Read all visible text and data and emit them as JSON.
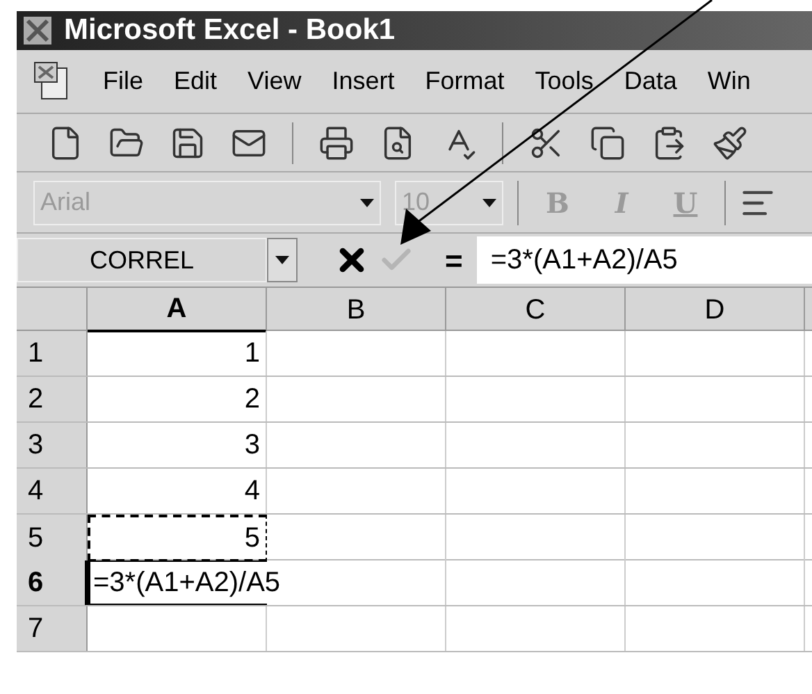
{
  "window": {
    "title": "Microsoft Excel - Book1"
  },
  "menu": [
    "File",
    "Edit",
    "View",
    "Insert",
    "Format",
    "Tools",
    "Data",
    "Win"
  ],
  "formatting": {
    "font": "Arial",
    "size": "10",
    "disabled": true,
    "styles": [
      "B",
      "I",
      "U"
    ]
  },
  "formula_bar": {
    "name_box": "CORREL",
    "equals": "=",
    "formula": "=3*(A1+A2)/A5",
    "enter_disabled": true
  },
  "sheet": {
    "columns": [
      {
        "label": "A",
        "selected": true
      },
      {
        "label": "B",
        "selected": false
      },
      {
        "label": "C",
        "selected": false
      },
      {
        "label": "D",
        "selected": false
      }
    ],
    "rows": [
      {
        "label": "1",
        "selected": false,
        "a": {
          "value": "1",
          "kind": "number",
          "marquee": false
        }
      },
      {
        "label": "2",
        "selected": false,
        "a": {
          "value": "2",
          "kind": "number",
          "marquee": false
        }
      },
      {
        "label": "3",
        "selected": false,
        "a": {
          "value": "3",
          "kind": "number",
          "marquee": false
        }
      },
      {
        "label": "4",
        "selected": false,
        "a": {
          "value": "4",
          "kind": "number",
          "marquee": false
        }
      },
      {
        "label": "5",
        "selected": false,
        "a": {
          "value": "5",
          "kind": "number",
          "marquee": true
        }
      },
      {
        "label": "6",
        "selected": true,
        "a": {
          "value": "=3*(A1+A2)/A5",
          "kind": "editing",
          "marquee": false
        }
      },
      {
        "label": "7",
        "selected": false
      }
    ]
  }
}
